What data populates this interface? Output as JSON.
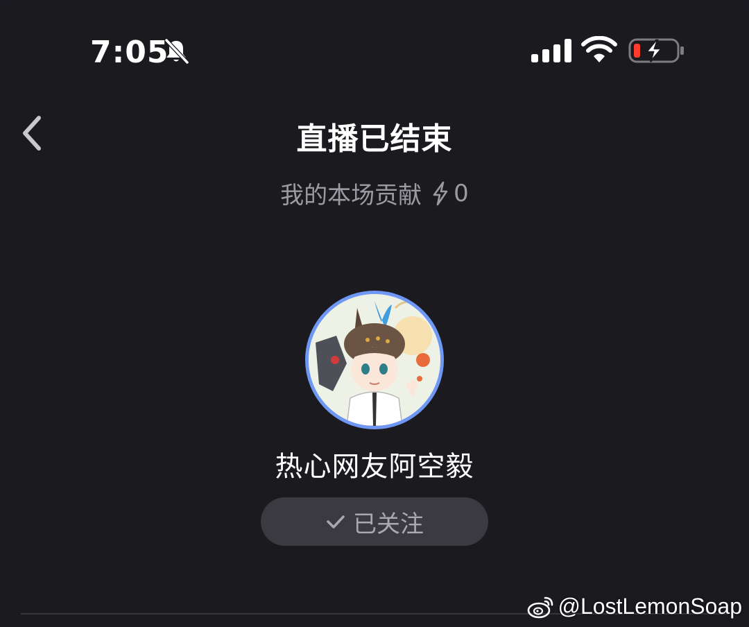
{
  "status_bar": {
    "time": "7:05",
    "icons": [
      "bell-slash-icon",
      "cellular-signal-icon",
      "wifi-icon",
      "battery-charging-icon"
    ],
    "battery_level_fraction": 0.12,
    "battery_level_color": "#ff3b30"
  },
  "header": {
    "back_icon": "chevron-left-icon",
    "title": "直播已结束"
  },
  "contribution": {
    "label": "我的本场贡献",
    "icon": "lightning-bolt-icon",
    "value": "0"
  },
  "host": {
    "avatar_icon": "avatar",
    "avatar_ring_color": "#6e98f4",
    "name": "热心网友阿空毅"
  },
  "follow_button": {
    "icon": "check-icon",
    "label": "已关注"
  },
  "watermark": {
    "icon": "weibo-icon",
    "text": "@LostLemonSoap"
  },
  "colors": {
    "background": "#1a1a1f",
    "button_background": "#3a3a40",
    "secondary_text": "#9c9ba2"
  }
}
